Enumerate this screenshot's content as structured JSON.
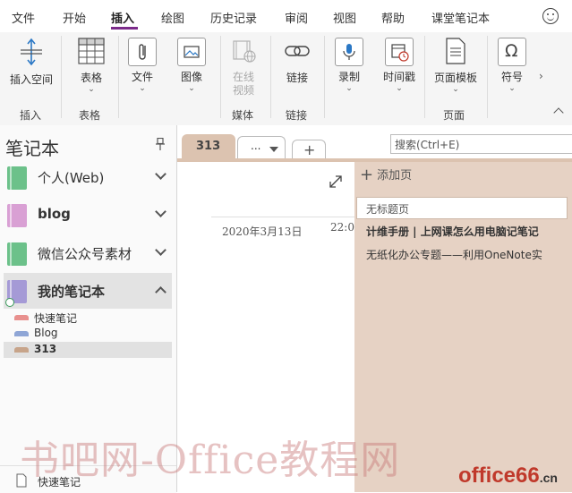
{
  "menu": {
    "items": [
      "文件",
      "开始",
      "插入",
      "绘图",
      "历史记录",
      "审阅",
      "视图",
      "帮助",
      "课堂笔记本"
    ],
    "active": "插入"
  },
  "ribbon": {
    "insert_space": "插入空间",
    "table": "表格",
    "file": "文件",
    "image": "图像",
    "online_video_line1": "在线",
    "online_video_line2": "视频",
    "link": "链接",
    "record": "录制",
    "timestamp": "时间戳",
    "page_template": "页面模板",
    "symbol": "符号",
    "groups": {
      "insert": "插入",
      "tables": "表格",
      "media": "媒体",
      "links": "链接",
      "pages": "页面"
    }
  },
  "notebooks": {
    "title": "笔记本",
    "items": [
      {
        "label": "个人(Web)",
        "color": "#6cc18a"
      },
      {
        "label": "blog",
        "color": "#d9a0d4"
      },
      {
        "label": "微信公众号素材",
        "color": "#6cc18a"
      },
      {
        "label": "我的笔记本",
        "color": "#a59ad6"
      }
    ],
    "sections": [
      {
        "label": "快速笔记",
        "color": "#e8908e"
      },
      {
        "label": "Blog",
        "color": "#8fa6d6"
      },
      {
        "label": "313",
        "color": "#c7a48a"
      }
    ],
    "quick_notes": "快速笔记"
  },
  "tabs": {
    "current": "313",
    "more": "...",
    "add": "+"
  },
  "search": {
    "placeholder": "搜索(Ctrl+E)"
  },
  "page": {
    "date": "2020年3月13日",
    "time": "22:0"
  },
  "pagelist": {
    "add_page": "添加页",
    "add_icon": "+",
    "untitled": "无标题页",
    "items": [
      "计维手册 | 上网课怎么用电脑记笔记",
      "无纸化办公专题——利用OneNote实"
    ]
  },
  "watermark": {
    "text": "书吧网-Office教程网",
    "logo_main": "office66",
    "logo_suffix": ".cn"
  }
}
